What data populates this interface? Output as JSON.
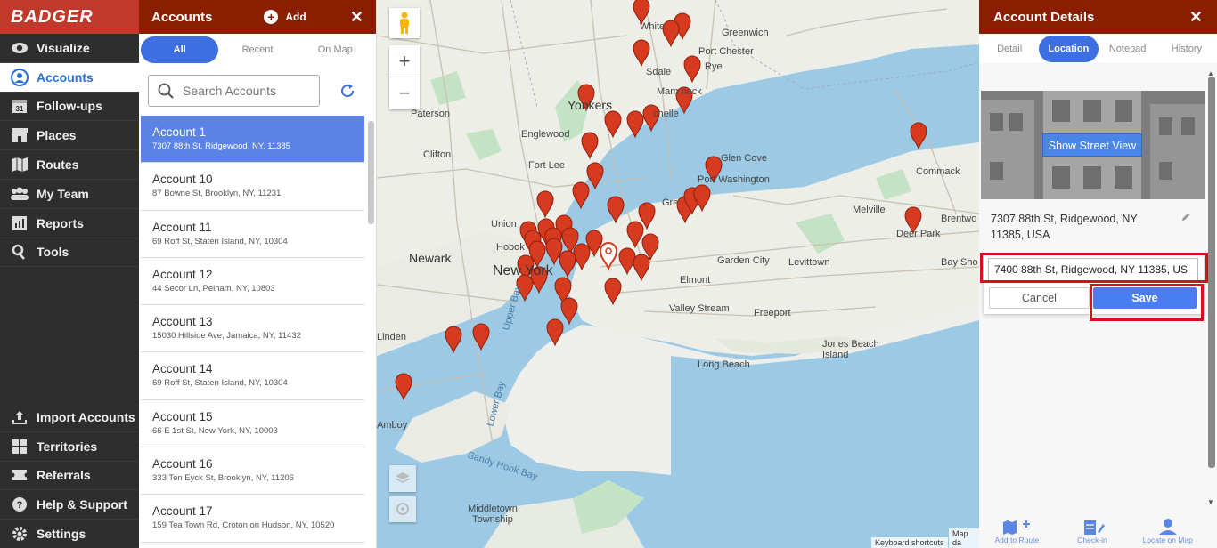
{
  "brand": "BADGER",
  "nav": {
    "top": [
      {
        "label": "Visualize",
        "icon": "eye-icon"
      },
      {
        "label": "Accounts",
        "icon": "user-circle-icon",
        "active": true
      },
      {
        "label": "Follow-ups",
        "icon": "calendar-icon",
        "badge": "31"
      },
      {
        "label": "Places",
        "icon": "store-icon"
      },
      {
        "label": "Routes",
        "icon": "map-icon"
      },
      {
        "label": "My Team",
        "icon": "team-icon"
      },
      {
        "label": "Reports",
        "icon": "reports-icon"
      },
      {
        "label": "Tools",
        "icon": "tools-icon"
      }
    ],
    "bottom": [
      {
        "label": "Import Accounts",
        "icon": "upload-icon"
      },
      {
        "label": "Territories",
        "icon": "grid-icon"
      },
      {
        "label": "Referrals",
        "icon": "ticket-icon"
      },
      {
        "label": "Help & Support",
        "icon": "help-icon"
      },
      {
        "label": "Settings",
        "icon": "gear-icon"
      }
    ]
  },
  "accounts": {
    "title": "Accounts",
    "add_label": "Add",
    "tabs": [
      "All",
      "Recent",
      "On Map"
    ],
    "search_placeholder": "Search Accounts",
    "items": [
      {
        "name": "Account 1",
        "address": "7307 88th St, Ridgewood, NY, 11385"
      },
      {
        "name": "Account 10",
        "address": "87 Bowne St, Brooklyn, NY, 11231"
      },
      {
        "name": "Account 11",
        "address": "69 Roff St, Staten Island, NY, 10304"
      },
      {
        "name": "Account 12",
        "address": "44 Secor Ln, Pelham, NY, 10803"
      },
      {
        "name": "Account 13",
        "address": "15030 Hillside Ave, Jamaica, NY, 11432"
      },
      {
        "name": "Account 14",
        "address": "69 Roff St, Staten Island, NY, 10304"
      },
      {
        "name": "Account 15",
        "address": "66 E 1st St, New York, NY, 10003"
      },
      {
        "name": "Account 16",
        "address": "333 Ten Eyck St, Brooklyn, NY, 11206"
      },
      {
        "name": "Account 17",
        "address": "159 Tea Town Rd, Croton on Hudson, NY, 10520"
      }
    ]
  },
  "map": {
    "labels": {
      "yonkers": "Yonkers",
      "paterson": "Paterson",
      "englewood": "Englewood",
      "clifton": "Clifton",
      "fort_lee": "Fort Lee",
      "union": "Union",
      "hoboken": "Hobok",
      "newark": "Newark",
      "new_york": "New York",
      "linden": "Linden",
      "amboy": "Amboy",
      "white_plains": "White",
      "greenwich": "Greenwich",
      "port_chester": "Port Chester",
      "rye": "Rye",
      "scarsdale": "Sdale",
      "mamaroneck": "Mam   neck",
      "new_rochelle": "chelle",
      "glen_cove": "Glen Cove",
      "port_washington": "Port Washington",
      "great_neck": "Gre",
      "garden_city": "Garden City",
      "levittown": "Levittown",
      "elmont": "Elmont",
      "valley_stream": "Valley Stream",
      "freeport": "Freeport",
      "jones_beach": "Jones Beach Island",
      "long_beach": "Long Beach",
      "melville": "Melville",
      "commack": "Commack",
      "deer_park": "Deer Park",
      "brentwood": "Brentwo",
      "bay_shore": "Bay Sho",
      "middletown": "Middletown Township",
      "sandy_hook": "Sandy Hook Bay",
      "lower_bay": "Lower Bay",
      "upper_bay": "Upper Bay",
      "keyboard_shortcuts": "Keyboard shortcuts",
      "map_data": "Map da"
    }
  },
  "details": {
    "title": "Account Details",
    "tabs": [
      "Detail",
      "Location",
      "Notepad",
      "History"
    ],
    "active_tab": "Location",
    "street_view_label": "Show Street View",
    "address_line1": "7307 88th St, Ridgewood, NY",
    "address_line2": "11385, USA",
    "edit_value": "7400 88th St, Ridgewood, NY 11385, US",
    "cancel_label": "Cancel",
    "save_label": "Save",
    "bottom": [
      {
        "label": "Add to Route",
        "icon": "map-plus-icon"
      },
      {
        "label": "Check-in",
        "icon": "checkin-icon"
      },
      {
        "label": "Locate on Map",
        "icon": "locate-pin-icon"
      }
    ]
  },
  "colors": {
    "brand_red": "#c0392b",
    "header_dark_red": "#8b1e00",
    "accent_blue": "#3d6fe0",
    "highlight_red": "#d6101e",
    "pin_red": "#d63b1f"
  }
}
